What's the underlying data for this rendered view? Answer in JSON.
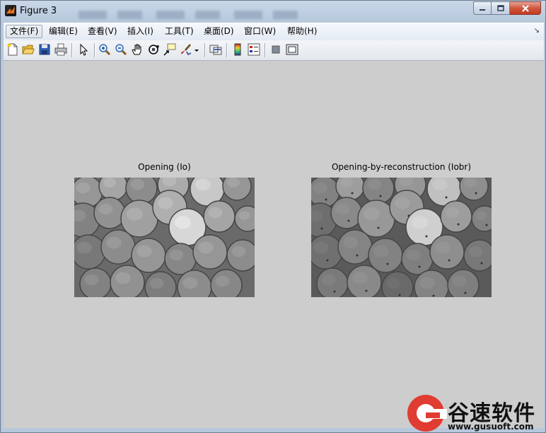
{
  "window": {
    "title": "Figure 3"
  },
  "menubar": {
    "items": [
      {
        "label": "文件(F)"
      },
      {
        "label": "编辑(E)"
      },
      {
        "label": "查看(V)"
      },
      {
        "label": "插入(I)"
      },
      {
        "label": "工具(T)"
      },
      {
        "label": "桌面(D)"
      },
      {
        "label": "窗口(W)"
      },
      {
        "label": "帮助(H)"
      }
    ],
    "overflow_arrow": "↘"
  },
  "toolbar": {
    "icons": [
      "new-figure-icon",
      "open-file-icon",
      "save-icon",
      "print-icon",
      "edit-plot-arrow-icon",
      "zoom-in-icon",
      "zoom-out-icon",
      "pan-hand-icon",
      "rotate-3d-icon",
      "data-cursor-icon",
      "brush-icon",
      "brush-dropdown-icon",
      "link-plot-icon",
      "insert-colorbar-icon",
      "insert-legend-icon",
      "hide-plot-tools-icon",
      "show-plot-tools-icon"
    ]
  },
  "axes": [
    {
      "title": "Opening (Io)"
    },
    {
      "title": "Opening-by-reconstruction (Iobr)"
    }
  ],
  "watermark": {
    "brand": "谷速软件",
    "url": "www.gusuoft.com"
  }
}
